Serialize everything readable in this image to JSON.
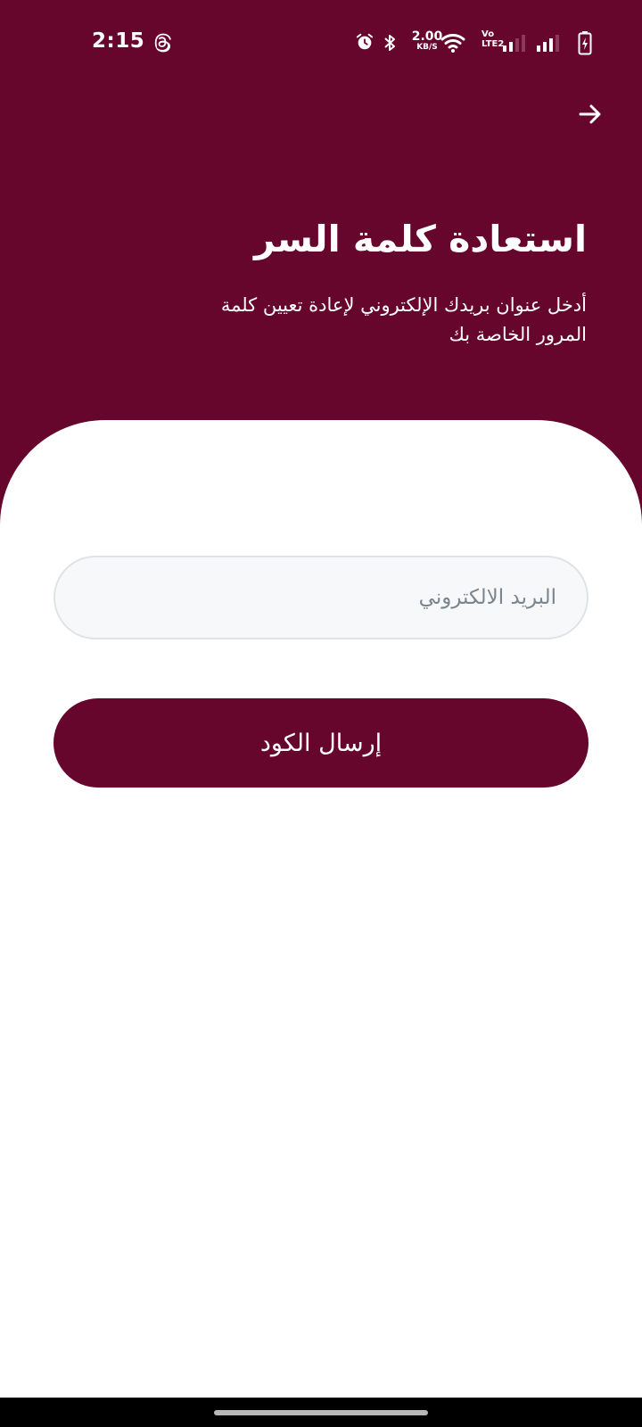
{
  "status_bar": {
    "time": "2:15",
    "network_speed_value": "2.00",
    "network_speed_unit": "KB/S",
    "volte_top": "Vo",
    "volte_bottom": "LTE2",
    "icons": [
      "threads-icon",
      "alarm-icon",
      "bluetooth-icon",
      "wifi-icon",
      "signal-icon",
      "signal-icon",
      "battery-charging-icon"
    ]
  },
  "header": {
    "back_icon": "arrow-right-icon",
    "title": "استعادة كلمة السر",
    "subtitle": "أدخل عنوان بريدك الإلكتروني لإعادة تعيين كلمة المرور الخاصة بك"
  },
  "form": {
    "email_value": "",
    "email_placeholder": "البريد الالكتروني",
    "submit_label": "إرسال الكود"
  },
  "colors": {
    "brand": "#67062d",
    "field_background": "#f6f8f9",
    "placeholder": "#7b858e"
  }
}
